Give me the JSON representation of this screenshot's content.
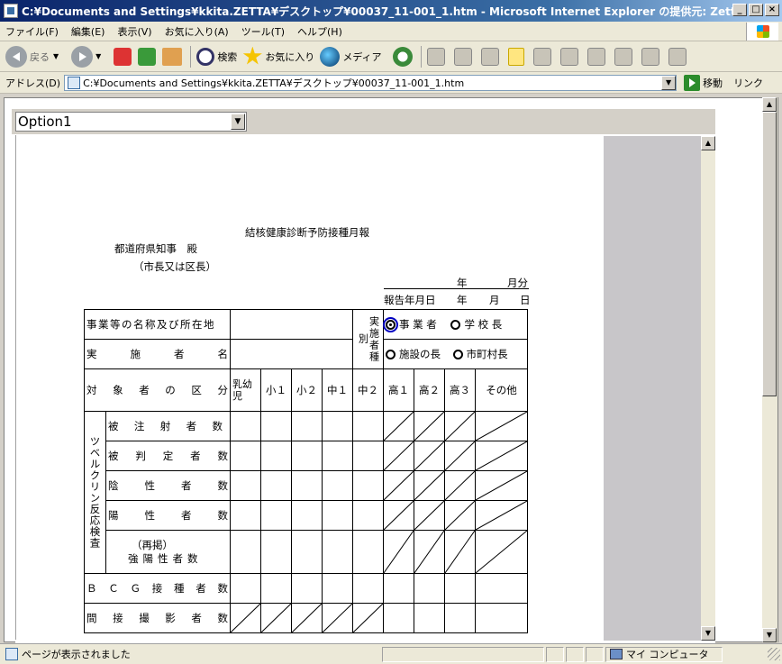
{
  "window": {
    "title": "C:¥Documents and Settings¥kkita.ZETTA¥デスクトップ¥00037_11-001_1.htm - Microsoft Internet Explorer の提供元: Zetta Technolo...",
    "buttons": [
      "_",
      "□",
      "×"
    ]
  },
  "menu": [
    "ファイル(F)",
    "編集(E)",
    "表示(V)",
    "お気に入り(A)",
    "ツール(T)",
    "ヘルプ(H)"
  ],
  "toolbar": {
    "back": "戻る",
    "search": "検索",
    "favorites": "お気に入り",
    "media": "メディア"
  },
  "address": {
    "label": "アドレス(D)",
    "value": "C:¥Documents and Settings¥kkita.ZETTA¥デスクトップ¥00037_11-001_1.htm",
    "go": "移動",
    "links": "リンク"
  },
  "select": {
    "value": "Option1"
  },
  "document": {
    "title": "結核健康診断予防接種月報",
    "addressee": "都道府県知事　殿",
    "addressee_sub": "（市長又は区長）",
    "year": "年",
    "month_part": "月分",
    "report_date_label": "報告年月日",
    "report_year": "年",
    "report_month": "月",
    "report_day": "日",
    "rows": {
      "name_location": "事業等の名称及び所在地",
      "implementer": "実施者名",
      "implementer_type": "実施者種別",
      "target_category": "対象者の区分",
      "tuberculin": "ツベルクリン反応検査",
      "injected": "被注射者数",
      "judged": "被判定者数",
      "negative": "陰性者数",
      "positive": "陽性者数",
      "repost": "（再掲）",
      "strong_positive": "強陽性者数",
      "bcg": "ＢＣＧ接種者数",
      "indirect": "間接撮影者数"
    },
    "radios": [
      "事 業 者",
      "学 校 長",
      "施設の長",
      "市町村長"
    ],
    "columns": [
      "乳幼児",
      "小１",
      "小２",
      "中１",
      "中２",
      "高１",
      "高２",
      "高３",
      "その他"
    ]
  },
  "status": {
    "text": "ページが表示されました",
    "zone": "マイ コンピュータ"
  }
}
